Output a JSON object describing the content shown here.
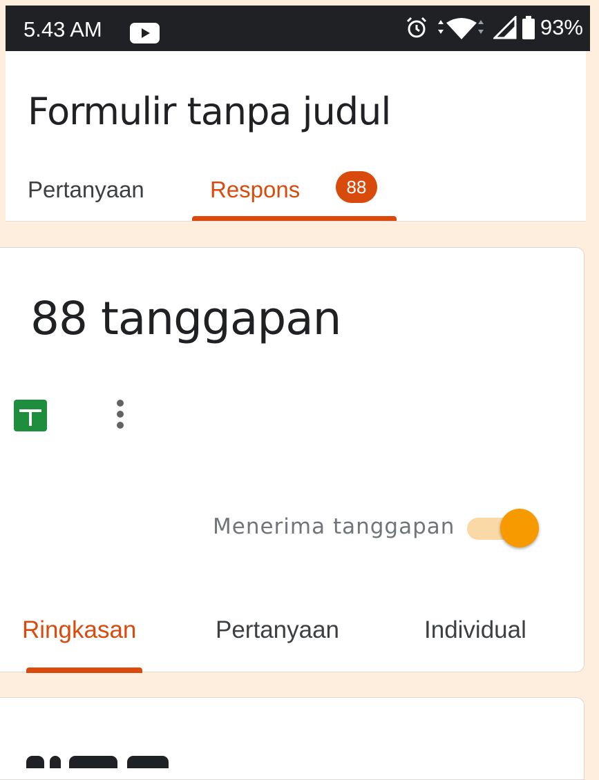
{
  "status_bar": {
    "time": "5.43 AM",
    "battery": "93%",
    "icons": [
      "youtube-icon",
      "alarm-icon",
      "wifi-icon",
      "signal-icon",
      "battery-icon"
    ]
  },
  "header": {
    "title": "Formulir tanpa judul",
    "tabs": [
      {
        "label": "Pertanyaan",
        "active": false
      },
      {
        "label": "Respons",
        "active": true,
        "badge": "88"
      }
    ]
  },
  "responses_card": {
    "title": "88 tanggapan",
    "icons": [
      "sheets-icon",
      "more-vert-icon"
    ],
    "accepting_label": "Menerima tanggapan",
    "accepting_on": true,
    "subtabs": [
      {
        "label": "Ringkasan",
        "active": true
      },
      {
        "label": "Pertanyaan",
        "active": false
      },
      {
        "label": "Individual",
        "active": false
      }
    ]
  },
  "colors": {
    "accent": "#d94b0c",
    "background": "#fdeede",
    "toggle": "#f79a00",
    "sheets": "#1e8e3e"
  }
}
